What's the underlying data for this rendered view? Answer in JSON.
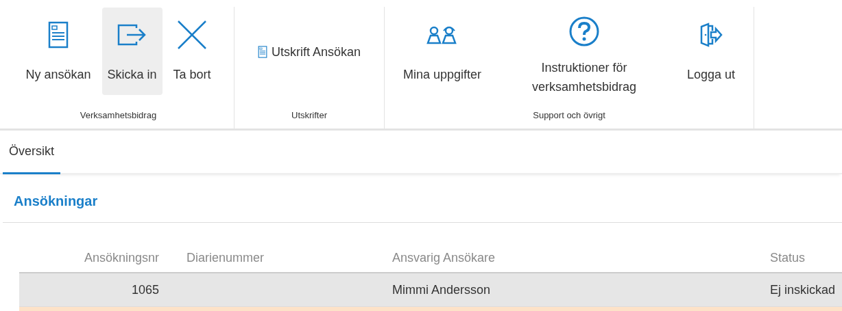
{
  "ribbon": {
    "groups": [
      {
        "label": "Verksamhetsbidrag",
        "kind": "large",
        "buttons": [
          {
            "label": "Ny ansökan",
            "kind": "document",
            "highlighted": false
          },
          {
            "label": "Skicka in",
            "kind": "send",
            "highlighted": true
          },
          {
            "label": "Ta bort",
            "kind": "close",
            "highlighted": false
          }
        ]
      },
      {
        "label": "Utskrifter",
        "kind": "compact",
        "buttons": [
          {
            "label": "Utskrift Ansökan",
            "kind": "document",
            "highlighted": false
          }
        ]
      },
      {
        "label": "Support och övrigt",
        "kind": "large",
        "buttons": [
          {
            "label": "Mina uppgifter",
            "kind": "people",
            "highlighted": false
          },
          {
            "label": "Instruktioner för verksamhetsbidrag",
            "kind": "help",
            "highlighted": false
          },
          {
            "label": "Logga ut",
            "kind": "logout",
            "highlighted": false
          }
        ]
      }
    ]
  },
  "tabs": [
    {
      "label": "Översikt",
      "selected": true
    }
  ],
  "section": {
    "title": "Ansökningar"
  },
  "table": {
    "columns": [
      "Ansökningsnr",
      "Diarienummer",
      "Ansvarig Ansökare",
      "Status"
    ],
    "rows": [
      {
        "cells": [
          "1065",
          "",
          "Mimmi Andersson",
          "Ej inskickad"
        ],
        "selected": true
      }
    ]
  }
}
